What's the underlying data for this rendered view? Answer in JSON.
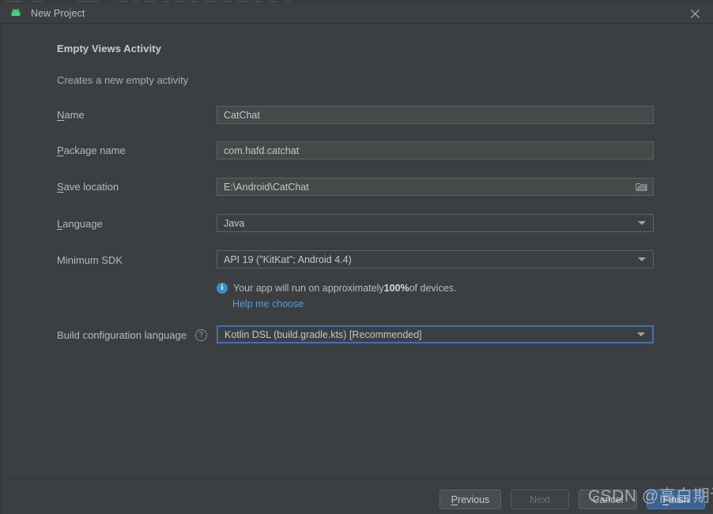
{
  "window": {
    "title": "New Project",
    "app_icon": "android-robot-icon",
    "close_label": "✕"
  },
  "header": {
    "title": "Empty Views Activity",
    "description": "Creates a new empty activity"
  },
  "form": {
    "fields": [
      {
        "id": "name",
        "label": "Name",
        "mnemonic": "N",
        "value": "CatChat",
        "type": "text"
      },
      {
        "id": "package-name",
        "label": "Package name",
        "mnemonic": "P",
        "value": "com.hafd.catchat",
        "type": "text"
      },
      {
        "id": "save-location",
        "label": "Save location",
        "mnemonic": "S",
        "value": "E:\\Android\\CatChat",
        "type": "text-with-browse",
        "browse_icon": "folder-icon"
      },
      {
        "id": "language",
        "label": "Language",
        "mnemonic": "L",
        "value": "Java",
        "type": "combo"
      },
      {
        "id": "minimum-sdk",
        "label": "Minimum SDK",
        "mnemonic": "",
        "value": "API 19 (\"KitKat\"; Android 4.4)",
        "type": "combo"
      },
      {
        "id": "build-configuration-language",
        "label": "Build configuration language",
        "mnemonic": "",
        "value": "Kotlin DSL (build.gradle.kts) [Recommended]",
        "type": "combo",
        "focused": true,
        "help_icon": "question-mark-icon"
      }
    ],
    "info": {
      "icon": "info-icon",
      "text_before": "Your app will run on approximately ",
      "percent": "100%",
      "text_after": " of devices.",
      "link": "Help me choose"
    }
  },
  "footer": {
    "buttons": [
      {
        "id": "previous",
        "label": "Previous",
        "mnemonic": "P",
        "state": "enabled"
      },
      {
        "id": "next",
        "label": "Next",
        "mnemonic": "",
        "state": "disabled"
      },
      {
        "id": "cancel",
        "label": "Cancel",
        "mnemonic": "",
        "state": "enabled"
      },
      {
        "id": "finish",
        "label": "Finish",
        "mnemonic": "F",
        "state": "primary"
      }
    ]
  },
  "watermark": {
    "text": "CSDN @高白期许"
  },
  "colors": {
    "window_background": "#3c3f41",
    "field_background": "#45494a",
    "field_border": "#5d6264",
    "focus_border": "#3d72b4",
    "accent_blue": "#3592c4",
    "link_blue": "#5a9ad4",
    "primary_button": "#3c628f",
    "text_primary": "#c9ccce",
    "text_secondary": "#a9acaf",
    "android_green": "#3ddc84"
  }
}
